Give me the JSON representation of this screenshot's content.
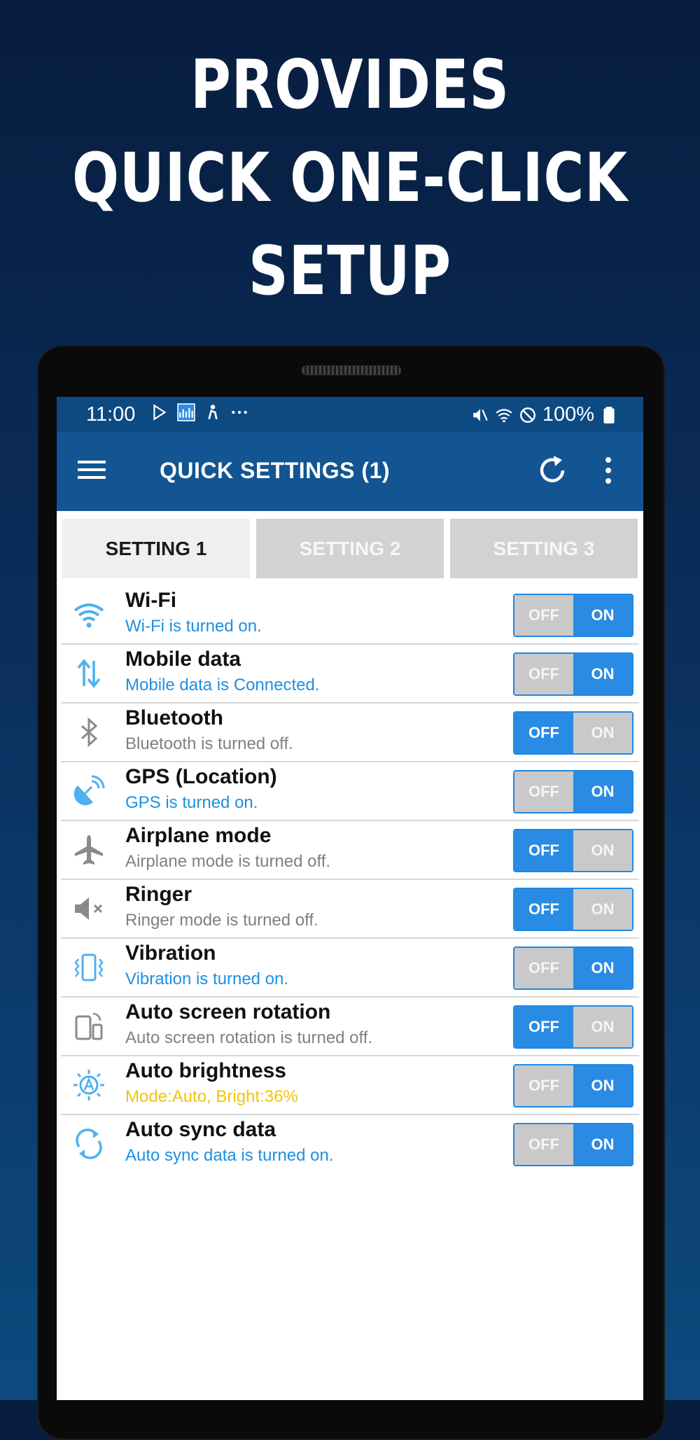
{
  "headline": {
    "line1": "PROVIDES",
    "line2": "QUICK ONE-CLICK",
    "line3": "SETUP"
  },
  "status_bar": {
    "time": "11:00",
    "battery": "100%",
    "icons": [
      "play-store-icon",
      "chart-icon",
      "accessibility-icon",
      "more-notifications-icon",
      "mute-icon",
      "wifi-icon",
      "block-icon",
      "battery-icon"
    ]
  },
  "app_bar": {
    "title": "QUICK SETTINGS (1)"
  },
  "tabs": [
    {
      "label": "SETTING 1",
      "active": true
    },
    {
      "label": "SETTING 2",
      "active": false
    },
    {
      "label": "SETTING 3",
      "active": false
    }
  ],
  "toggle_labels": {
    "off": "OFF",
    "on": "ON"
  },
  "settings": [
    {
      "title": "Wi-Fi",
      "status": "Wi-Fi is turned on.",
      "state": "on",
      "icon": "wifi-icon"
    },
    {
      "title": "Mobile data",
      "status": "Mobile data is Connected.",
      "state": "on",
      "icon": "mobile-data-icon"
    },
    {
      "title": "Bluetooth",
      "status": "Bluetooth is turned off.",
      "state": "off",
      "icon": "bluetooth-icon"
    },
    {
      "title": "GPS (Location)",
      "status": "GPS is turned on.",
      "state": "on",
      "icon": "gps-icon"
    },
    {
      "title": "Airplane mode",
      "status": "Airplane mode is turned off.",
      "state": "off",
      "icon": "airplane-icon"
    },
    {
      "title": "Ringer",
      "status": "Ringer mode is turned off.",
      "state": "off",
      "icon": "ringer-muted-icon"
    },
    {
      "title": "Vibration",
      "status": "Vibration is turned on.",
      "state": "on",
      "icon": "vibration-icon"
    },
    {
      "title": "Auto screen rotation",
      "status": "Auto screen rotation is turned off.",
      "state": "off",
      "icon": "screen-rotation-icon"
    },
    {
      "title": "Auto brightness",
      "status": "Mode:Auto, Bright:36%",
      "state": "on",
      "icon": "auto-brightness-icon",
      "status_color": "#f2c40a"
    },
    {
      "title": "Auto sync data",
      "status": "Auto sync data is turned on.",
      "state": "on",
      "icon": "sync-icon"
    }
  ],
  "colors": {
    "accent_blue": "#2a8be5",
    "app_bar": "#125592",
    "status_bar": "#0e4a82",
    "status_on": "#1e8fe2",
    "status_off": "#808080",
    "status_warn": "#f2c40a"
  }
}
